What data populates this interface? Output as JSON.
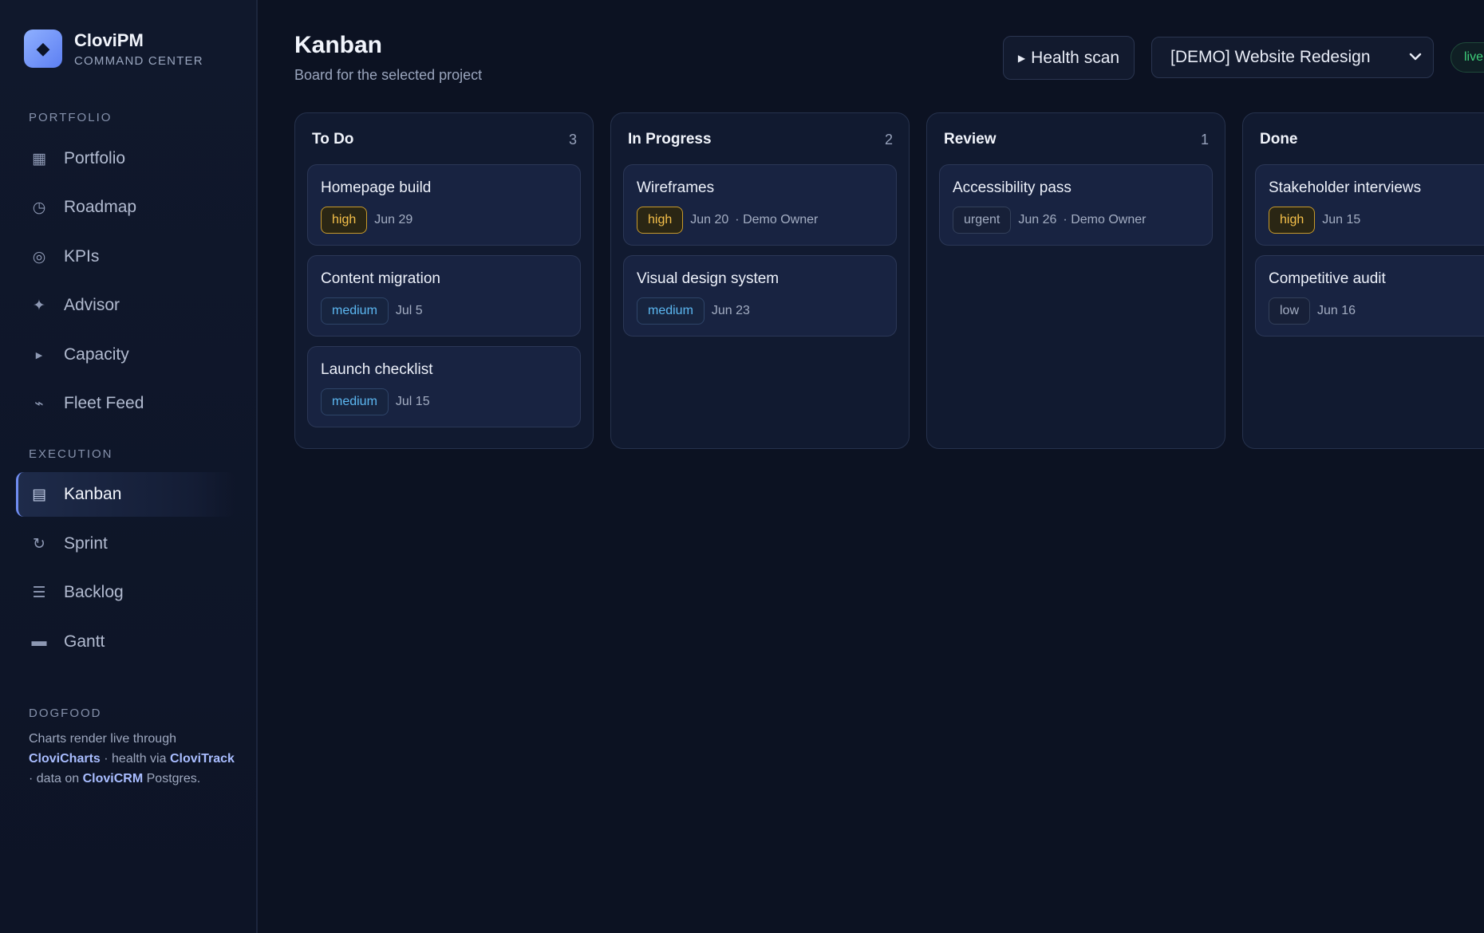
{
  "brand": {
    "logo_icon": "diamond-icon",
    "name": "CloviPM",
    "subtitle": "COMMAND CENTER"
  },
  "sidebar": {
    "portfolio_label": "PORTFOLIO",
    "portfolio_items": [
      {
        "label": "Portfolio",
        "icon": "grid-icon"
      },
      {
        "label": "Roadmap",
        "icon": "clock-icon"
      },
      {
        "label": "KPIs",
        "icon": "target-icon"
      },
      {
        "label": "Advisor",
        "icon": "sparkle-icon"
      },
      {
        "label": "Capacity",
        "icon": "play-icon"
      },
      {
        "label": "Fleet Feed",
        "icon": "pulse-icon"
      }
    ],
    "execution_label": "EXECUTION",
    "execution_items": [
      {
        "label": "Kanban",
        "icon": "board-icon",
        "active": true
      },
      {
        "label": "Sprint",
        "icon": "refresh-icon"
      },
      {
        "label": "Backlog",
        "icon": "list-icon"
      },
      {
        "label": "Gantt",
        "icon": "bar-icon"
      }
    ],
    "dogfood_label": "DOGFOOD",
    "dogfood": {
      "t1": "Charts render live through ",
      "b1": "CloviCharts",
      "t2": " · health via ",
      "b2": "CloviTrack",
      "t3": " · data on ",
      "b3": "CloviCRM",
      "t4": " Postgres."
    }
  },
  "header": {
    "title": "Kanban",
    "subtitle": "Board for the selected project",
    "health_button": "Health scan",
    "project_select": "[DEMO] Website Redesign",
    "live_badge": "live"
  },
  "colors": {
    "accent": "#6f8cf0",
    "high": "#f5c04a",
    "medium": "#5cb8f2",
    "live": "#3ecf7a"
  },
  "board": {
    "columns": [
      {
        "title": "To Do",
        "count": "3",
        "cards": [
          {
            "title": "Homepage build",
            "priority": "high",
            "date": "Jun 29",
            "owner": ""
          },
          {
            "title": "Content migration",
            "priority": "medium",
            "date": "Jul 5",
            "owner": ""
          },
          {
            "title": "Launch checklist",
            "priority": "medium",
            "date": "Jul 15",
            "owner": ""
          }
        ]
      },
      {
        "title": "In Progress",
        "count": "2",
        "cards": [
          {
            "title": "Wireframes",
            "priority": "high",
            "date": "Jun 20",
            "owner": "· Demo Owner"
          },
          {
            "title": "Visual design system",
            "priority": "medium",
            "date": "Jun 23",
            "owner": ""
          }
        ]
      },
      {
        "title": "Review",
        "count": "1",
        "cards": [
          {
            "title": "Accessibility pass",
            "priority": "urgent",
            "date": "Jun 26",
            "owner": "· Demo Owner"
          }
        ]
      },
      {
        "title": "Done",
        "count": "",
        "cards": [
          {
            "title": "Stakeholder interviews",
            "priority": "high",
            "date": "Jun 15",
            "owner": ""
          },
          {
            "title": "Competitive audit",
            "priority": "low",
            "date": "Jun 16",
            "owner": ""
          }
        ]
      }
    ]
  }
}
